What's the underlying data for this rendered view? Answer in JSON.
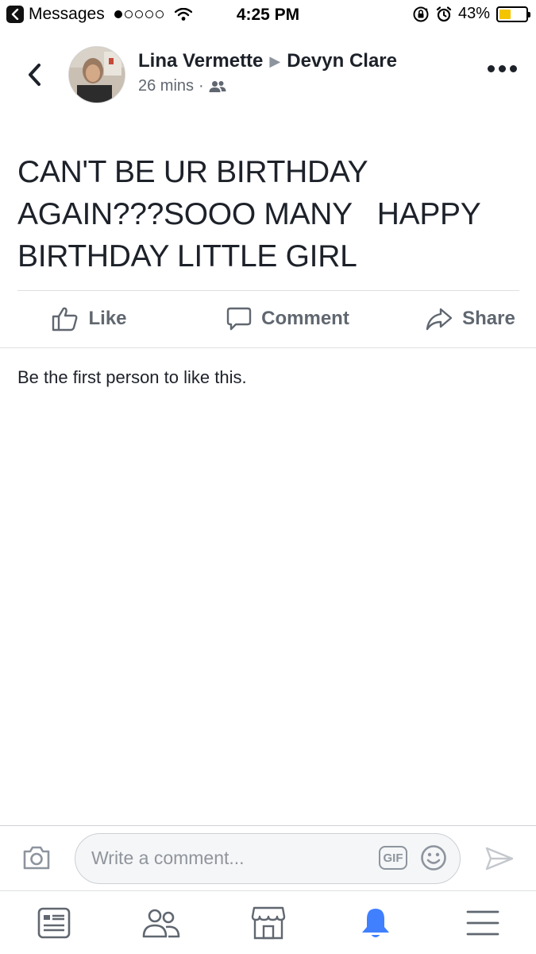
{
  "status_bar": {
    "back_app": "Messages",
    "time": "4:25 PM",
    "battery_text": "43%",
    "battery_level": 0.43,
    "signal_bars_filled": 1,
    "signal_bars_total": 5
  },
  "post": {
    "author": "Lina Vermette",
    "recipient": "Devyn Clare",
    "timestamp": "26 mins",
    "audience_icon": "friends-icon",
    "text": "CAN'T BE UR BIRTHDAY\nAGAIN???SOOO MANY   HAPPY\nBIRTHDAY LITTLE GIRL"
  },
  "actions": {
    "like_label": "Like",
    "comment_label": "Comment",
    "share_label": "Share"
  },
  "likes_summary": "Be the first person to like this.",
  "composer": {
    "placeholder": "Write a comment...",
    "gif_label": "GIF"
  },
  "tab_bar": {
    "items": [
      "news-feed-icon",
      "friends-icon",
      "marketplace-icon",
      "notifications-icon",
      "menu-icon"
    ],
    "active": "notifications-icon"
  },
  "colors": {
    "accent": "#4080ff",
    "text_primary": "#1d2129",
    "text_secondary": "#606770",
    "battery": "#f4c400"
  }
}
